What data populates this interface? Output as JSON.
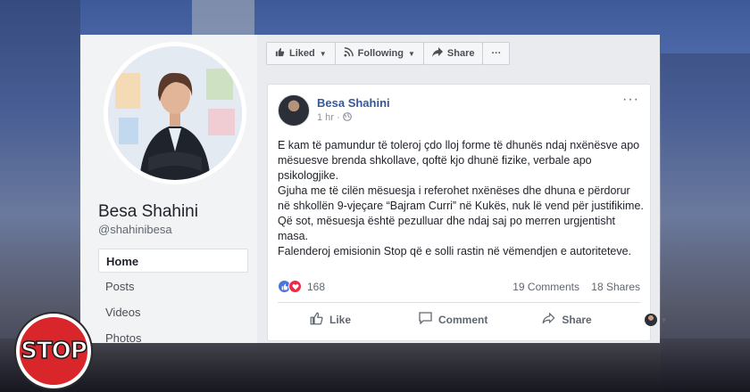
{
  "profile": {
    "name": "Besa Shahini",
    "handle": "@shahinibesa",
    "nav": [
      {
        "label": "Home",
        "active": true
      },
      {
        "label": "Posts"
      },
      {
        "label": "Videos"
      },
      {
        "label": "Photos"
      }
    ]
  },
  "page_actions": {
    "liked": "Liked",
    "following": "Following",
    "share": "Share",
    "more": "···"
  },
  "post": {
    "author": "Besa Shahini",
    "time": "1 hr",
    "audience_icon": "globe-icon",
    "more": "···",
    "paragraphs": [
      "E kam të pamundur të toleroj çdo lloj forme të dhunës ndaj nxënësve apo mësuesve brenda shkollave, qoftë kjo dhunë fizike, verbale apo psikologjike.",
      "Gjuha me të cilën mësuesja i referohet nxënëses dhe dhuna e përdorur në shkollën 9-vjeçare “Bajram Curri” në Kukës, nuk lë vend për justifikime.",
      "Që sot, mësuesja është pezulluar dhe ndaj saj po merren urgjentisht masa.",
      "Falenderoj emisionin Stop që e solli rastin në vëmendjen e autoriteteve."
    ],
    "reaction_count": "168",
    "comments": "19 Comments",
    "shares": "18 Shares",
    "actions": {
      "like": "Like",
      "comment": "Comment",
      "share": "Share"
    }
  },
  "logo": {
    "text": "STOP"
  },
  "colors": {
    "facebook_blue": "#365899",
    "stop_red": "#d8262b"
  }
}
